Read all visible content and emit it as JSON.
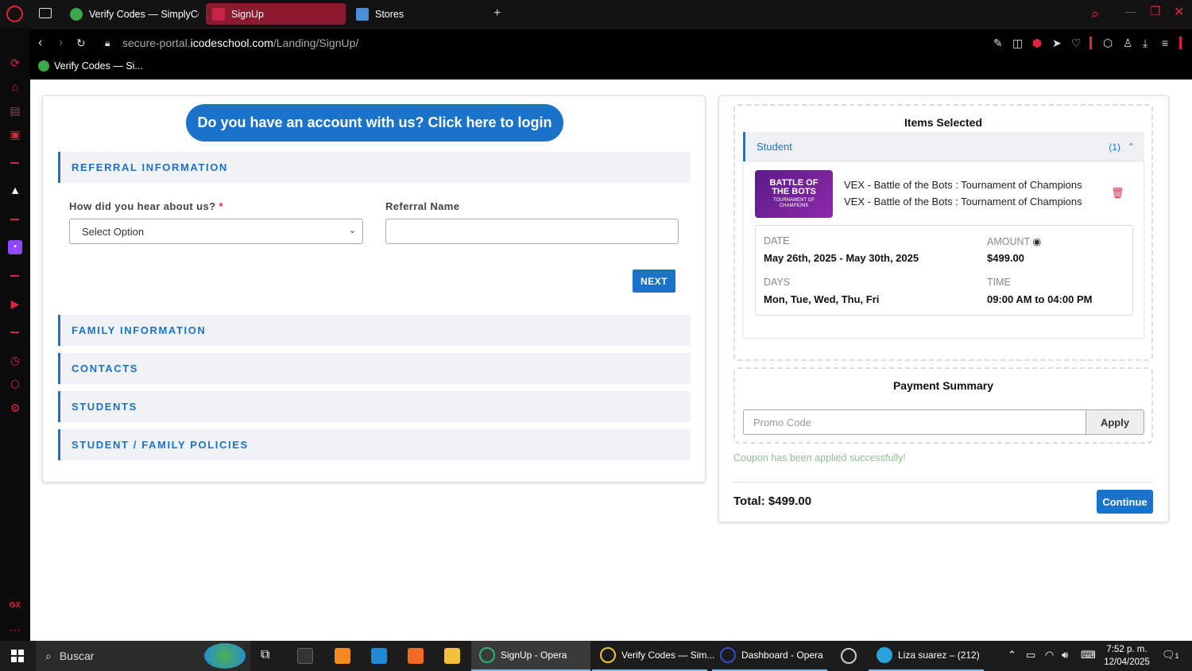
{
  "browser": {
    "tabs": [
      {
        "label": "Verify Codes — SimplyCo",
        "active": false
      },
      {
        "label": "SignUp",
        "active": true
      },
      {
        "label": "Stores",
        "active": false
      }
    ],
    "new_tab": "+",
    "url_prefix": "secure-portal.",
    "url_domain": "icodeschool.com",
    "url_path": "/Landing/SignUp/",
    "bookmark": "Verify Codes — Si...",
    "window_controls": {
      "search": "⌕",
      "minimize": "—",
      "maximize": "❐",
      "close": "✕"
    }
  },
  "signup": {
    "login_prompt": "Do you have an account with us? Click here to login",
    "sections": {
      "referral": "REFERRAL INFORMATION",
      "family": "FAMILY INFORMATION",
      "contacts": "CONTACTS",
      "students": "STUDENTS",
      "policies": "STUDENT / FAMILY POLICIES"
    },
    "hear_label": "How did you hear about us?",
    "required_mark": "*",
    "hear_value": "Select Option",
    "referral_label": "Referral Name",
    "referral_value": "",
    "next": "NEXT"
  },
  "cart": {
    "items_title": "Items Selected",
    "group_label": "Student",
    "group_count": "(1)",
    "item": {
      "thumb_line1": "BATTLE OF",
      "thumb_line2": "THE BOTS",
      "thumb_sub": "TOURNAMENT OF CHAMPIONS",
      "name1": "VEX - Battle of the Bots : Tournament of Champions",
      "name2": "VEX - Battle of the Bots : Tournament of Champions",
      "date_label": "DATE",
      "date_value": "May 26th, 2025 - May 30th, 2025",
      "amount_label": "AMOUNT",
      "amount_value": "$499.00",
      "days_label": "DAYS",
      "days_value": "Mon, Tue, Wed, Thu, Fri",
      "time_label": "TIME",
      "time_value": "09:00 AM to 04:00 PM"
    },
    "payment_title": "Payment Summary",
    "promo_placeholder": "Promo Code",
    "apply": "Apply",
    "coupon_msg": "Coupon has been applied successfully!",
    "total": "Total: $499.00",
    "continue": "Continue"
  },
  "taskbar": {
    "search": "Buscar",
    "apps": [
      {
        "label": "SignUp - Opera"
      },
      {
        "label": "Verify Codes — Sim..."
      },
      {
        "label": "Dashboard - Opera"
      },
      {
        "label": "Liza suarez – (212)"
      }
    ],
    "time": "7:52 p. m.",
    "date": "12/04/2025",
    "notif_count": "1"
  },
  "colors": {
    "accent": "#1b73c9",
    "opera_red": "#e0223f",
    "coupon_green": "#8fbf8f"
  }
}
